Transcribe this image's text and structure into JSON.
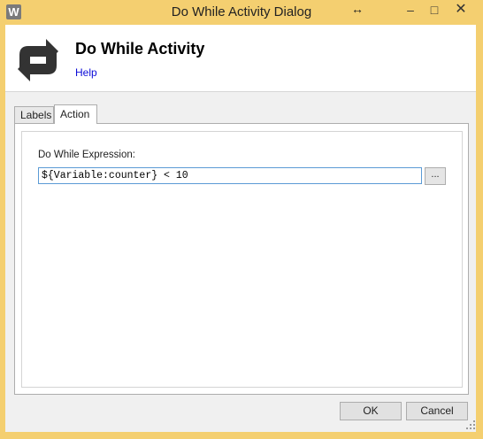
{
  "window": {
    "app_icon_letter": "W",
    "title": "Do While Activity Dialog",
    "resize_glyph": "↔",
    "minimize_glyph": "–",
    "maximize_glyph": "□",
    "close_glyph": "✕"
  },
  "header": {
    "icon": "loop-arrows-icon",
    "title": "Do While Activity",
    "help_link": "Help"
  },
  "tabs": [
    {
      "label": "Labels",
      "selected": false
    },
    {
      "label": "Action",
      "selected": true
    }
  ],
  "action": {
    "expression_label": "Do While Expression:",
    "expression_value": "${Variable:counter} < 10",
    "browse_label": "..."
  },
  "buttons": {
    "ok": "OK",
    "cancel": "Cancel"
  },
  "colors": {
    "frame": "#f4cf70",
    "link": "#0b0bd8",
    "input_focus_border": "#5b9bd5"
  }
}
